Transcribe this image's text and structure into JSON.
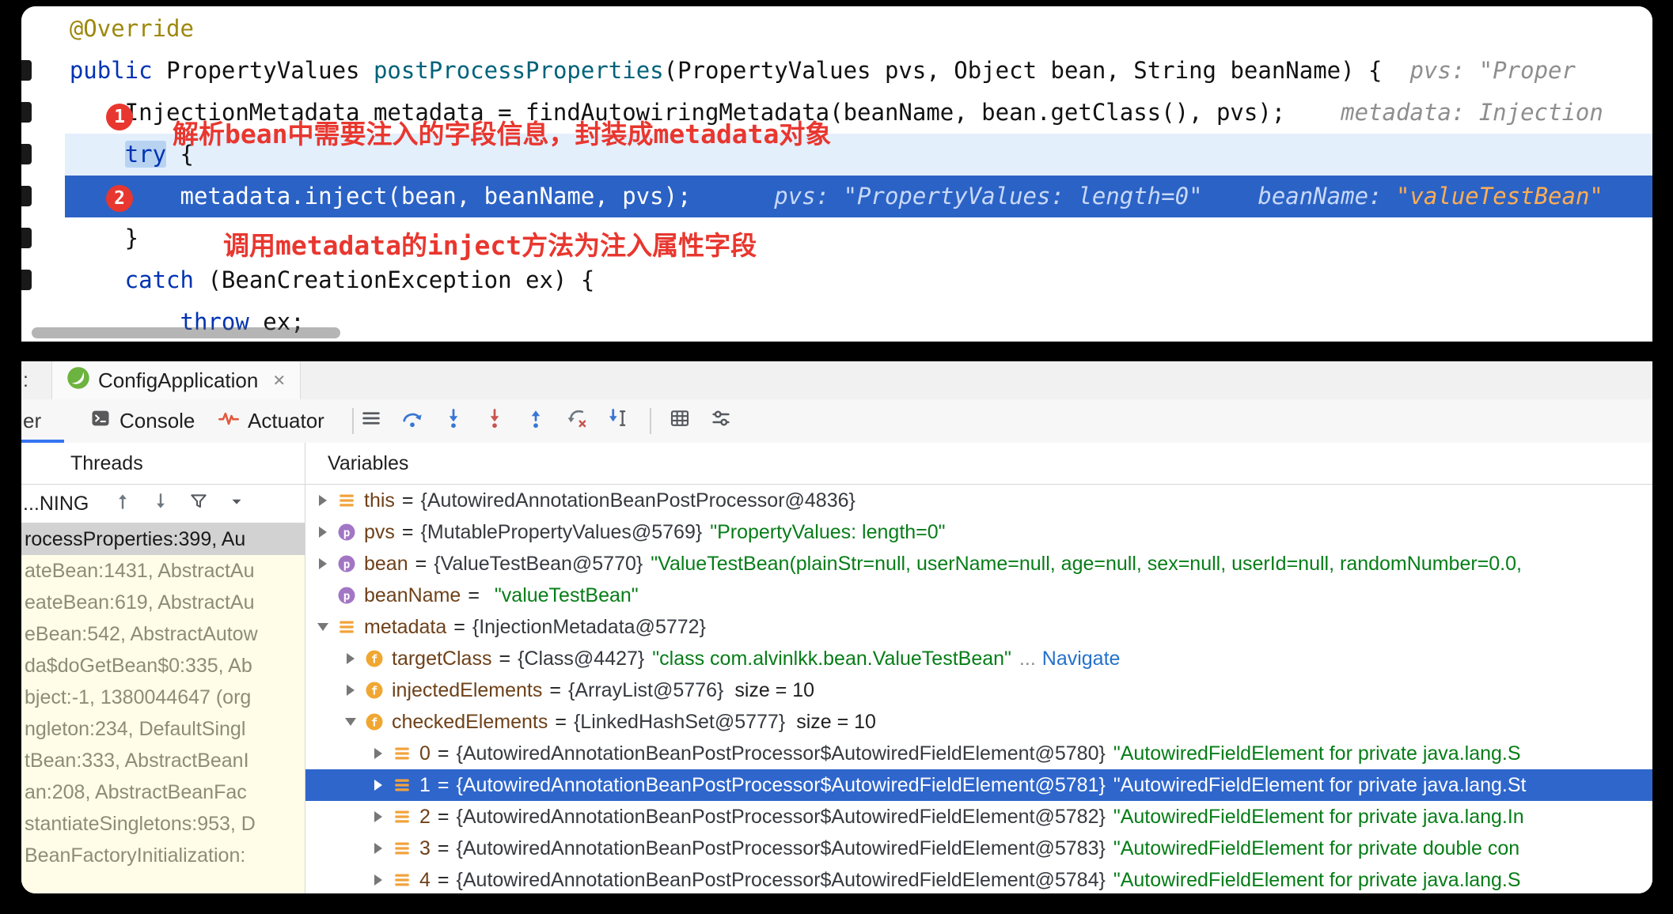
{
  "editor": {
    "code_lines": [
      {
        "tokens": [
          {
            "s": "anno",
            "t": "    @Override"
          }
        ]
      },
      {
        "tokens": [
          {
            "s": "kw",
            "t": "    public "
          },
          {
            "s": "plain",
            "t": "PropertyValues "
          },
          {
            "s": "decl",
            "t": "postProcessProperties"
          },
          {
            "s": "plain",
            "t": "(PropertyValues pvs, Object bean, String beanName) {  "
          },
          {
            "s": "hint",
            "t": "pvs: \"Proper"
          }
        ]
      },
      {
        "tokens": [
          {
            "s": "plain",
            "t": "        InjectionMetadata metadata = findAutowiringMetadata(beanName, bean.getClass(), pvs);    "
          },
          {
            "s": "hint",
            "t": "metadata: Injection"
          }
        ]
      },
      {
        "highlight": "light",
        "tokens": [
          {
            "s": "plain",
            "t": "        "
          },
          {
            "s": "kwsel",
            "t": "try"
          },
          {
            "s": "plain",
            "t": " {"
          }
        ]
      },
      {
        "highlight": "exec",
        "tokens": [
          {
            "s": "exec",
            "t": "            metadata.inject(bean, beanName, pvs);      "
          },
          {
            "s": "hintExec",
            "t": "pvs: \"PropertyValues: length=0\""
          },
          {
            "s": "exec",
            "t": "    "
          },
          {
            "s": "hintExec",
            "t": "beanName: "
          },
          {
            "s": "hintOrange",
            "t": "\"valueTestBean\""
          }
        ]
      },
      {
        "tokens": [
          {
            "s": "plain",
            "t": "        }"
          }
        ]
      },
      {
        "tokens": [
          {
            "s": "kw",
            "t": "        catch"
          },
          {
            "s": "plain",
            "t": " (BeanCreationException ex) {"
          }
        ]
      },
      {
        "tokens": [
          {
            "s": "kw",
            "t": "            throw"
          },
          {
            "s": "plain",
            "t": " ex;"
          }
        ]
      }
    ],
    "badges": [
      {
        "label": "1"
      },
      {
        "label": "2"
      }
    ],
    "notes": [
      {
        "text": "解析bean中需要注入的字段信息，封装成metadata对象"
      },
      {
        "text": "调用metadata的inject方法为注入属性字段"
      }
    ]
  },
  "debug": {
    "fragments": {
      "tab_bar": ":",
      "toolbar": "er"
    },
    "run_tab": {
      "label": "ConfigApplication",
      "close_glyph": "✕",
      "icon": "spring-boot-icon"
    },
    "tool_tabs": [
      {
        "label": "Console",
        "icon": "console-icon"
      },
      {
        "label": "Actuator",
        "icon": "actuator-icon"
      }
    ],
    "toolbar_icons": [
      "layout-menu-icon",
      "step-over-icon",
      "step-into-icon",
      "force-step-into-icon",
      "step-out-icon",
      "drop-frame-icon",
      "run-to-cursor-icon",
      "separator",
      "view-grid-icon",
      "adjust-lines-icon"
    ],
    "threads": {
      "header": "Threads",
      "filter_text": "...NING",
      "toolbar_icons": [
        "frame-up-icon",
        "frame-down-icon",
        "filter-funnel-icon",
        "chevron-down-icon"
      ],
      "frames": [
        {
          "text": "rocessProperties:399, Au",
          "selected": true
        },
        {
          "text": "ateBean:1431, AbstractAu"
        },
        {
          "text": "eateBean:619, AbstractAu"
        },
        {
          "text": "eBean:542, AbstractAutow"
        },
        {
          "text": "da$doGetBean$0:335, Ab"
        },
        {
          "text": "bject:-1, 1380044647 (org"
        },
        {
          "text": "ngleton:234, DefaultSingl"
        },
        {
          "text": "tBean:333, AbstractBeanI"
        },
        {
          "text": "an:208, AbstractBeanFac"
        },
        {
          "text": "stantiateSingletons:953, D"
        },
        {
          "text": "BeanFactoryInitialization:"
        },
        {
          "text": ""
        }
      ]
    },
    "variables": {
      "header": "Variables",
      "rows": [
        {
          "level": 0,
          "chevron": "right",
          "icon": "value",
          "name": "this",
          "ref": "{AutowiredAnnotationBeanPostProcessor@4836}"
        },
        {
          "level": 0,
          "chevron": "right",
          "icon": "param",
          "name": "pvs",
          "ref": "{MutablePropertyValues@5769}",
          "str": "\"PropertyValues: length=0\""
        },
        {
          "level": 0,
          "chevron": "right",
          "icon": "param",
          "name": "bean",
          "ref": "{ValueTestBean@5770}",
          "str": "\"ValueTestBean(plainStr=null, userName=null, age=null, sex=null, userId=null, randomNumber=0.0,"
        },
        {
          "level": 0,
          "chevron": "none",
          "icon": "param",
          "name": "beanName",
          "str": "\"valueTestBean\""
        },
        {
          "level": 0,
          "chevron": "down",
          "icon": "value",
          "name": "metadata",
          "ref": "{InjectionMetadata@5772}"
        },
        {
          "level": 1,
          "chevron": "right",
          "icon": "field",
          "name": "targetClass",
          "ref": "{Class@4427}",
          "str": "\"class com.alvinlkk.bean.ValueTestBean\"",
          "more": "...",
          "link": "Navigate"
        },
        {
          "level": 1,
          "chevron": "right",
          "icon": "field",
          "name": "injectedElements",
          "ref": "{ArrayList@5776}",
          "size": "size = 10"
        },
        {
          "level": 1,
          "chevron": "down",
          "icon": "field",
          "name": "checkedElements",
          "ref": "{LinkedHashSet@5777}",
          "size": "size = 10"
        },
        {
          "level": 2,
          "chevron": "right",
          "icon": "value",
          "name": "0",
          "ref": "{AutowiredAnnotationBeanPostProcessor$AutowiredFieldElement@5780}",
          "str": "\"AutowiredFieldElement for private java.lang.S"
        },
        {
          "level": 2,
          "chevron": "right",
          "icon": "value",
          "name": "1",
          "ref": "{AutowiredAnnotationBeanPostProcessor$AutowiredFieldElement@5781}",
          "str": "\"AutowiredFieldElement for private java.lang.St",
          "selected": true
        },
        {
          "level": 2,
          "chevron": "right",
          "icon": "value",
          "name": "2",
          "ref": "{AutowiredAnnotationBeanPostProcessor$AutowiredFieldElement@5782}",
          "str": "\"AutowiredFieldElement for private java.lang.In"
        },
        {
          "level": 2,
          "chevron": "right",
          "icon": "value",
          "name": "3",
          "ref": "{AutowiredAnnotationBeanPostProcessor$AutowiredFieldElement@5783}",
          "str": "\"AutowiredFieldElement for private double con"
        },
        {
          "level": 2,
          "chevron": "right",
          "icon": "value",
          "name": "4",
          "ref": "{AutowiredAnnotationBeanPostProcessor$AutowiredFieldElement@5784}",
          "str": "\"AutowiredFieldElement for private java.lang.S"
        }
      ]
    }
  },
  "colors": {
    "execution_line_blue": "#2B62C6",
    "selection_blue": "#2F66CC",
    "annotation_red": "#E8372F",
    "frame_bg_yellow": "#FFFDE7",
    "string_green": "#067D17",
    "keyword_blue": "#0033B3"
  }
}
